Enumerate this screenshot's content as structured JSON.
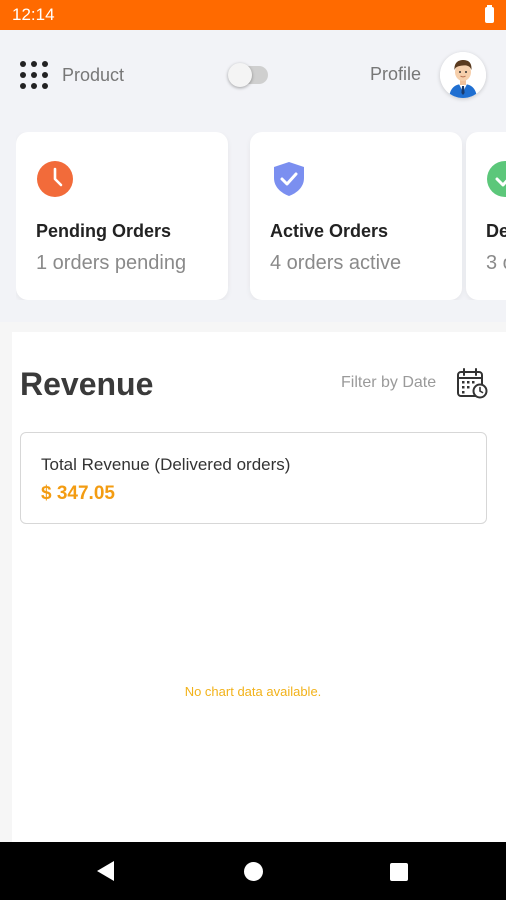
{
  "status_bar": {
    "time": "12:14"
  },
  "header": {
    "product_label": "Product",
    "profile_label": "Profile"
  },
  "cards": [
    {
      "title": "Pending Orders",
      "subtitle": "1 orders pending",
      "icon": "clock-icon",
      "color": "#f26b3a"
    },
    {
      "title": "Active Orders",
      "subtitle": "4 orders active",
      "icon": "shield-check-icon",
      "color": "#7b8ff0"
    },
    {
      "title": "De",
      "subtitle": "3 o",
      "icon": "check-circle-icon",
      "color": "#5cc77a"
    }
  ],
  "revenue": {
    "title": "Revenue",
    "filter_label": "Filter by Date",
    "total_label": "Total Revenue (Delivered orders)",
    "total_value": "$ 347.05",
    "empty_message": "No chart data available."
  },
  "colors": {
    "accent": "#ff6a00",
    "revenue_value": "#f39c12",
    "empty_message": "#f2b21a"
  }
}
